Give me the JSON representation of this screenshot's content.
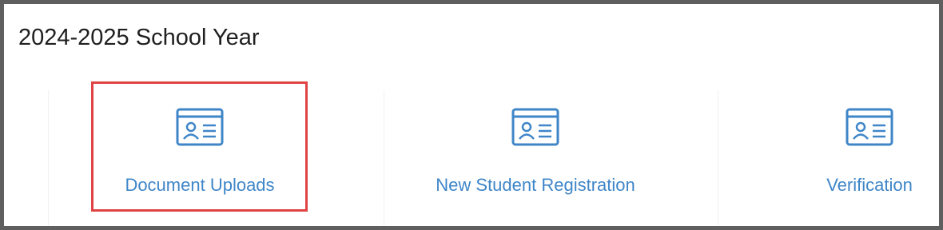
{
  "section": {
    "title": "2024-2025 School Year"
  },
  "tiles": [
    {
      "label": "Document Uploads",
      "icon": "id-card-icon"
    },
    {
      "label": "New Student Registration",
      "icon": "id-card-icon"
    },
    {
      "label": "Verification",
      "icon": "id-card-icon"
    }
  ],
  "colors": {
    "link": "#3f86c8",
    "highlight": "#e04343",
    "frame": "#5f5f5f"
  }
}
